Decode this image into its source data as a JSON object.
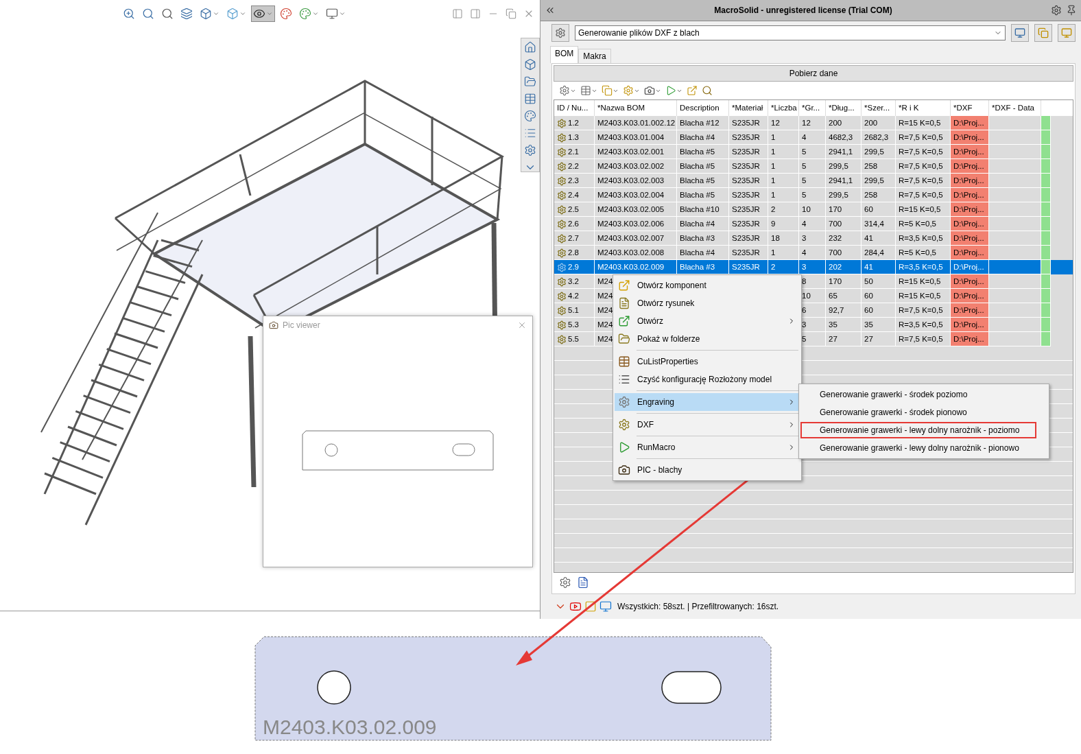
{
  "cad_toolbar": [
    {
      "dropdown": false,
      "selected": false
    },
    {
      "dropdown": false,
      "selected": false
    },
    {
      "dropdown": false,
      "selected": false
    },
    {
      "dropdown": false,
      "selected": false
    },
    {
      "dropdown": true,
      "selected": false
    },
    {
      "dropdown": true,
      "selected": false
    },
    {
      "dropdown": true,
      "selected": true
    },
    {
      "dropdown": false,
      "selected": false
    },
    {
      "dropdown": true,
      "selected": false
    },
    {
      "dropdown": true,
      "selected": false
    }
  ],
  "pic_viewer": {
    "title": "Pic viewer"
  },
  "panel": {
    "title": "MacroSolid - unregistered license (Trial COM)",
    "macro_combo": {
      "value": "Generowanie plików DXF z blach"
    },
    "tabs": [
      {
        "label": "BOM",
        "selected": true
      },
      {
        "label": "Makra",
        "selected": false
      }
    ],
    "fetch_button": "Pobierz dane",
    "table": {
      "columns": [
        "ID / Nu...",
        "*Nazwa BOM",
        "Description",
        "*Materiał",
        "*Liczba",
        "*Gr...",
        "*Dług...",
        "*Szer...",
        "*R i K",
        "*DXF",
        "*DXF - Data"
      ],
      "rows": [
        {
          "selected": false,
          "cells": [
            "1.2",
            "M2403.K03.01.002.12",
            "Blacha #12",
            "S235JR",
            "12",
            "12",
            "200",
            "200",
            "R=15 K=0,5",
            "D:\\Proj..."
          ]
        },
        {
          "selected": false,
          "cells": [
            "1.3",
            "M2403.K03.01.004",
            "Blacha #4",
            "S235JR",
            "1",
            "4",
            "4682,3",
            "2682,3",
            "R=7,5 K=0,5",
            "D:\\Proj..."
          ]
        },
        {
          "selected": false,
          "cells": [
            "2.1",
            "M2403.K03.02.001",
            "Blacha #5",
            "S235JR",
            "1",
            "5",
            "2941,1",
            "299,5",
            "R=7,5 K=0,5",
            "D:\\Proj..."
          ]
        },
        {
          "selected": false,
          "cells": [
            "2.2",
            "M2403.K03.02.002",
            "Blacha #5",
            "S235JR",
            "1",
            "5",
            "299,5",
            "258",
            "R=7,5 K=0,5",
            "D:\\Proj..."
          ]
        },
        {
          "selected": false,
          "cells": [
            "2.3",
            "M2403.K03.02.003",
            "Blacha #5",
            "S235JR",
            "1",
            "5",
            "2941,1",
            "299,5",
            "R=7,5 K=0,5",
            "D:\\Proj..."
          ]
        },
        {
          "selected": false,
          "cells": [
            "2.4",
            "M2403.K03.02.004",
            "Blacha #5",
            "S235JR",
            "1",
            "5",
            "299,5",
            "258",
            "R=7,5 K=0,5",
            "D:\\Proj..."
          ]
        },
        {
          "selected": false,
          "cells": [
            "2.5",
            "M2403.K03.02.005",
            "Blacha #10",
            "S235JR",
            "2",
            "10",
            "170",
            "60",
            "R=15 K=0,5",
            "D:\\Proj..."
          ]
        },
        {
          "selected": false,
          "cells": [
            "2.6",
            "M2403.K03.02.006",
            "Blacha #4",
            "S235JR",
            "9",
            "4",
            "700",
            "314,4",
            "R=5 K=0,5",
            "D:\\Proj..."
          ]
        },
        {
          "selected": false,
          "cells": [
            "2.7",
            "M2403.K03.02.007",
            "Blacha #3",
            "S235JR",
            "18",
            "3",
            "232",
            "41",
            "R=3,5 K=0,5",
            "D:\\Proj..."
          ]
        },
        {
          "selected": false,
          "cells": [
            "2.8",
            "M2403.K03.02.008",
            "Blacha #4",
            "S235JR",
            "1",
            "4",
            "700",
            "284,4",
            "R=5 K=0,5",
            "D:\\Proj..."
          ]
        },
        {
          "selected": true,
          "cells": [
            "2.9",
            "M2403.K03.02.009",
            "Blacha #3",
            "S235JR",
            "2",
            "3",
            "202",
            "41",
            "R=3,5 K=0,5",
            "D:\\Proj..."
          ]
        },
        {
          "selected": false,
          "cells": [
            "3.2",
            "M24",
            null,
            null,
            null,
            "8",
            "170",
            "50",
            "R=15 K=0,5",
            "D:\\Proj..."
          ]
        },
        {
          "selected": false,
          "cells": [
            "4.2",
            "M24",
            null,
            null,
            null,
            "10",
            "65",
            "60",
            "R=15 K=0,5",
            "D:\\Proj..."
          ]
        },
        {
          "selected": false,
          "cells": [
            "5.1",
            "M24",
            null,
            null,
            null,
            "6",
            "92,7",
            "60",
            "R=7,5 K=0,5",
            "D:\\Proj..."
          ]
        },
        {
          "selected": false,
          "cells": [
            "5.3",
            "M24",
            null,
            null,
            null,
            "3",
            "35",
            "35",
            "R=3,5 K=0,5",
            "D:\\Proj..."
          ]
        },
        {
          "selected": false,
          "cells": [
            "5.5",
            "M24",
            null,
            null,
            null,
            "5",
            "27",
            "27",
            "R=7,5 K=0,5",
            "D:\\Proj..."
          ]
        }
      ]
    },
    "context_menu": [
      {
        "label": "Otwórz komponent",
        "has_submenu": false,
        "selected": false,
        "separator_before": false
      },
      {
        "label": "Otwórz rysunek",
        "has_submenu": false,
        "selected": false,
        "separator_before": false
      },
      {
        "label": "Otwórz",
        "has_submenu": true,
        "selected": false,
        "separator_before": false
      },
      {
        "label": "Pokaż w folderze",
        "has_submenu": false,
        "selected": false,
        "separator_before": false
      },
      {
        "label": "CuListProperties",
        "has_submenu": false,
        "selected": false,
        "separator_before": true
      },
      {
        "label": "Czyść konfigurację Rozłożony model",
        "has_submenu": false,
        "selected": false,
        "separator_before": false
      },
      {
        "label": "Engraving",
        "has_submenu": true,
        "selected": true,
        "separator_before": true
      },
      {
        "label": "DXF",
        "has_submenu": true,
        "selected": false,
        "separator_before": true
      },
      {
        "label": "RunMacro",
        "has_submenu": true,
        "selected": false,
        "separator_before": true
      },
      {
        "label": "PIC - blachy",
        "has_submenu": false,
        "selected": false,
        "separator_before": true
      }
    ],
    "submenu": [
      {
        "label": "Generowanie grawerki - środek poziomo",
        "highlighted": false
      },
      {
        "label": "Generowanie grawerki - środek pionowo",
        "highlighted": false
      },
      {
        "label": "Generowanie grawerki - lewy dolny narożnik - poziomo",
        "highlighted": true
      },
      {
        "label": "Generowanie grawerki - lewy dolny narożnik - pionowo",
        "highlighted": false
      }
    ],
    "status": "Wszystkich: 58szt. | Przefiltrowanych: 16szt."
  },
  "sheet_drawing": {
    "engraving_text": "M2403.K03.02.009"
  }
}
